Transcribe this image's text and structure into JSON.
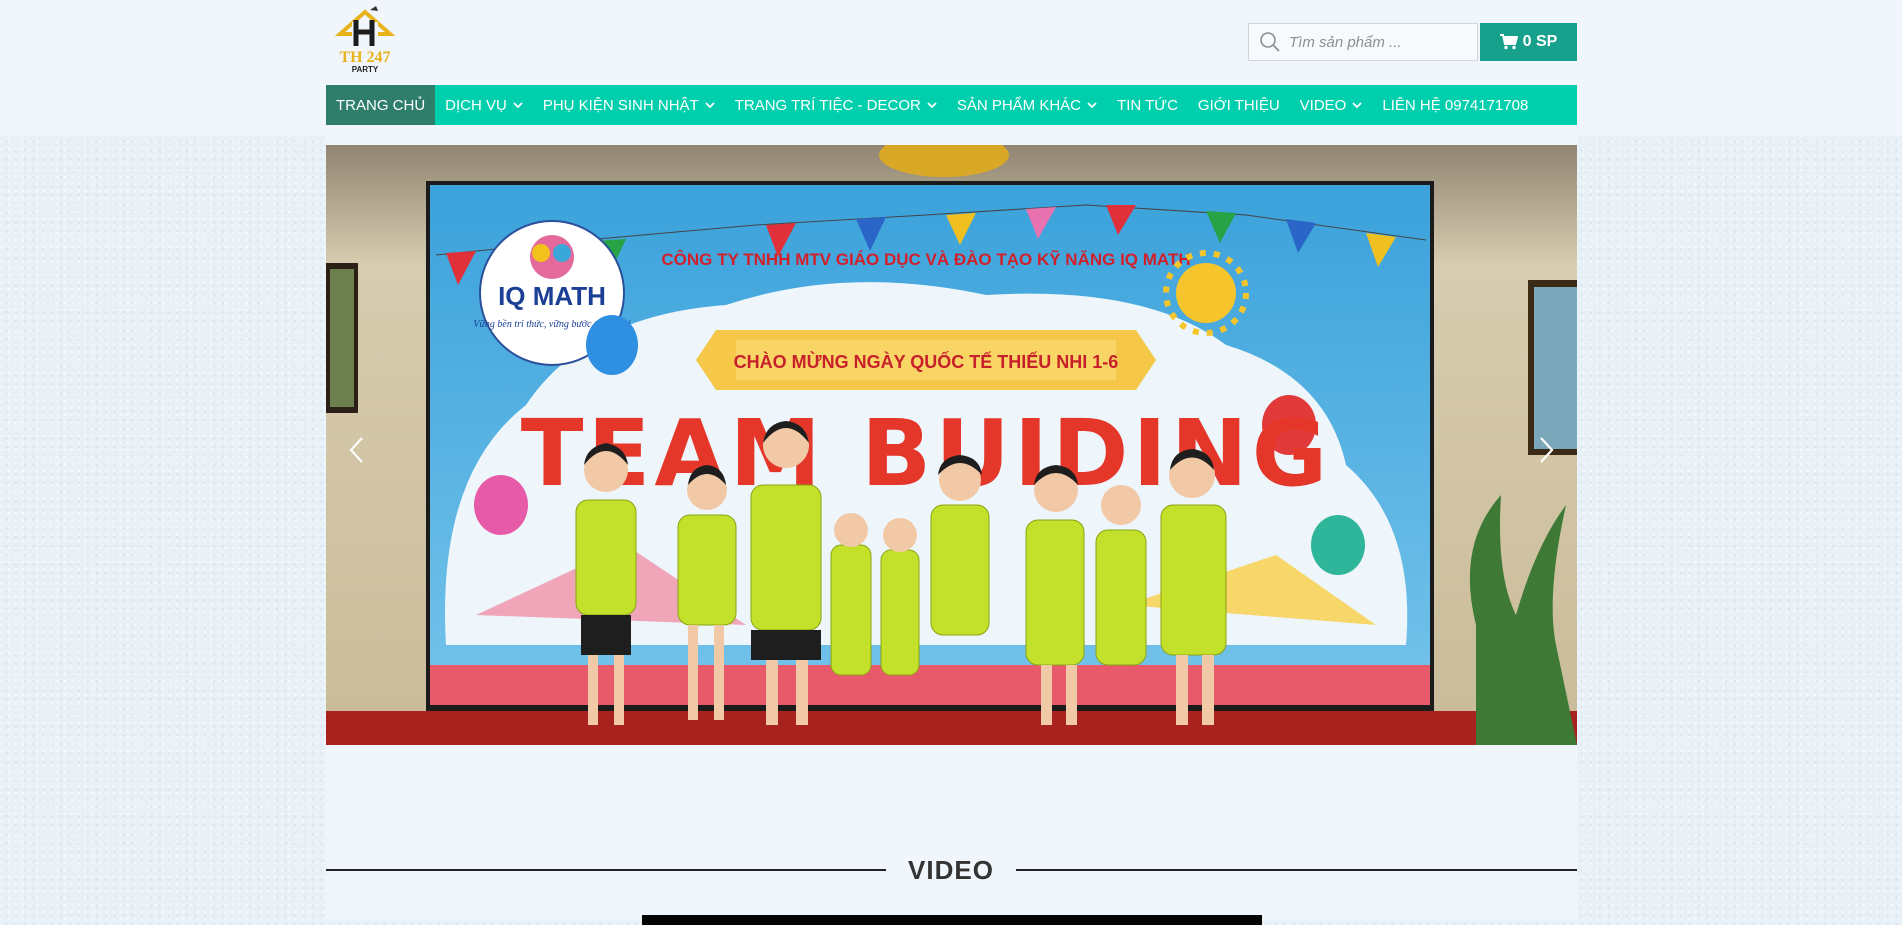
{
  "header": {
    "logo": {
      "line1": "TH 247",
      "line2": "PARTY"
    },
    "search": {
      "placeholder": "Tìm sản phẩm ...",
      "value": ""
    },
    "cart": {
      "label": "0 SP",
      "icon": "cart-icon"
    }
  },
  "nav": {
    "items": [
      {
        "label": "TRANG CHỦ",
        "active": true,
        "dropdown": false
      },
      {
        "label": "DỊCH VỤ",
        "dropdown": true
      },
      {
        "label": "PHỤ KIỆN SINH NHẬT",
        "dropdown": true
      },
      {
        "label": "TRANG TRÍ TIỆC - DECOR",
        "dropdown": true
      },
      {
        "label": "SẢN PHẨM KHÁC",
        "dropdown": true
      },
      {
        "label": "TIN TỨC",
        "dropdown": false
      },
      {
        "label": "GIỚI THIỆU",
        "dropdown": false
      },
      {
        "label": "VIDEO",
        "dropdown": true
      },
      {
        "label": "LIÊN HỆ 0974171708",
        "dropdown": false
      }
    ]
  },
  "slider": {
    "banner_company": "CÔNG TY TNHH MTV GIÁO DỤC VÀ ĐÀO TẠO KỸ NĂNG IQ MATH",
    "banner_ribbon": "CHÀO MỪNG NGÀY QUỐC TẾ THIẾU NHI 1-6",
    "banner_headline": "TEAM BUIDING",
    "banner_logo_text": "IQ MATH",
    "banner_logo_slogan": "Vững bền tri thức, vững bước tương lai"
  },
  "section": {
    "title": "VIDEO"
  },
  "colors": {
    "nav_bg": "#00cfad",
    "nav_active": "#2f7e6b",
    "cart_bg": "#17a08c",
    "page_bg": "#f1f6fc"
  }
}
